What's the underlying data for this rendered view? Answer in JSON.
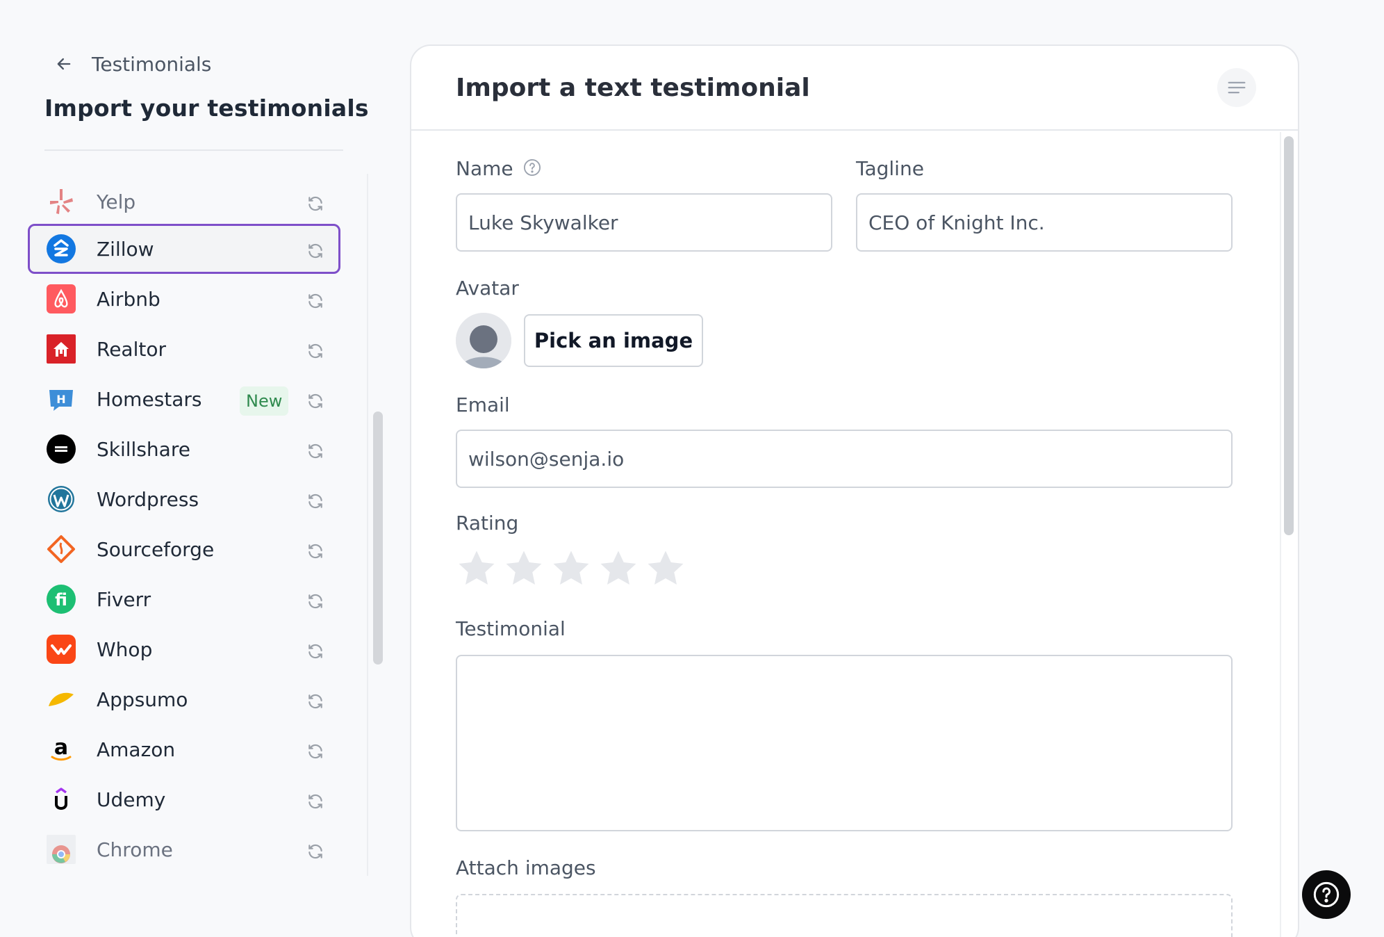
{
  "sidebar": {
    "back_label": "Testimonials",
    "title": "Import your testimonials",
    "new_badge": "New",
    "sources": [
      {
        "label": "Yelp",
        "icon": "yelp-icon",
        "color": "#d32323"
      },
      {
        "label": "Zillow",
        "icon": "zillow-icon",
        "color": "#1277e1",
        "selected": true
      },
      {
        "label": "Airbnb",
        "icon": "airbnb-icon",
        "color": "#ff5a5f"
      },
      {
        "label": "Realtor",
        "icon": "realtor-icon",
        "color": "#d92228"
      },
      {
        "label": "Homestars",
        "icon": "homestars-icon",
        "color": "#3d8ed8",
        "badge": "New"
      },
      {
        "label": "Skillshare",
        "icon": "skillshare-icon",
        "color": "#000000"
      },
      {
        "label": "Wordpress",
        "icon": "wordpress-icon",
        "color": "#21759b"
      },
      {
        "label": "Sourceforge",
        "icon": "sourceforge-icon",
        "color": "#f26522"
      },
      {
        "label": "Fiverr",
        "icon": "fiverr-icon",
        "color": "#1dbf73"
      },
      {
        "label": "Whop",
        "icon": "whop-icon",
        "color": "#fa4616"
      },
      {
        "label": "Appsumo",
        "icon": "appsumo-icon",
        "color": "#f5b800"
      },
      {
        "label": "Amazon",
        "icon": "amazon-icon",
        "color": "#000000"
      },
      {
        "label": "Udemy",
        "icon": "udemy-icon",
        "color": "#a435f0"
      },
      {
        "label": "Chrome",
        "icon": "chrome-icon",
        "color": "#4285f4"
      }
    ]
  },
  "form": {
    "title": "Import a text testimonial",
    "name_label": "Name",
    "name_value": "Luke Skywalker",
    "tagline_label": "Tagline",
    "tagline_value": "CEO of Knight Inc.",
    "avatar_label": "Avatar",
    "pick_image_label": "Pick an image",
    "email_label": "Email",
    "email_value": "wilson@senja.io",
    "rating_label": "Rating",
    "rating_value": 0,
    "rating_max": 5,
    "testimonial_label": "Testimonial",
    "testimonial_value": "",
    "attach_label": "Attach images"
  },
  "colors": {
    "selected_border": "#7e4fc9",
    "badge_bg": "#e7f6ec",
    "badge_text": "#2f8a4e",
    "star_empty": "#e5e7eb"
  }
}
